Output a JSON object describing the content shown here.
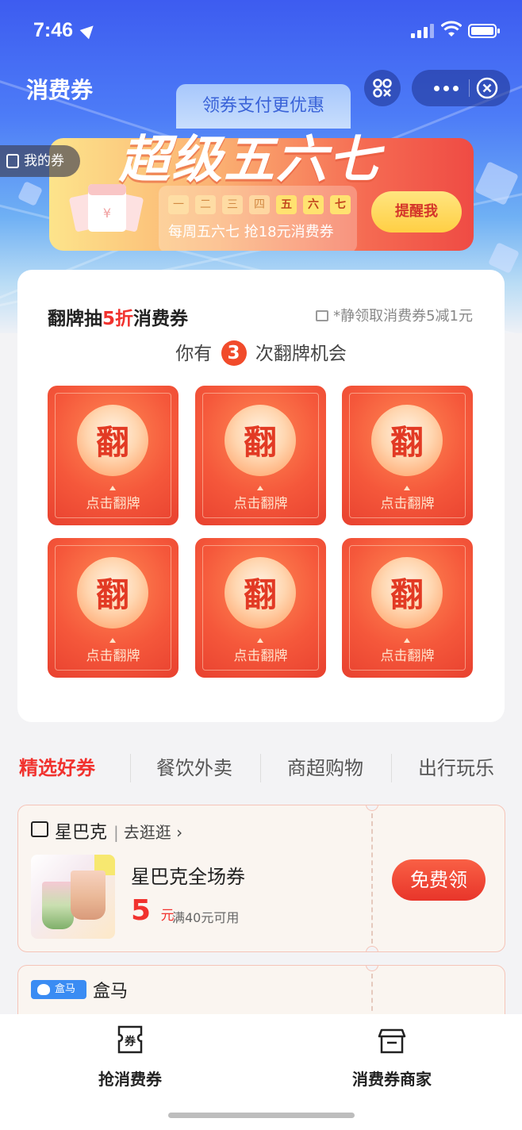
{
  "status_bar": {
    "time": "7:46"
  },
  "nav": {
    "title": "消费券"
  },
  "banner": {
    "tab_label": "领券支付更优惠",
    "headline": "超级五六七",
    "my_coupons": "我的券",
    "days": [
      "一",
      "二",
      "三",
      "四",
      "五",
      "六",
      "七"
    ],
    "subtitle": "每周五六七 抢18元消费券",
    "remind_label": "提醒我"
  },
  "flip": {
    "title_prefix": "翻牌抽",
    "title_highlight": "5折",
    "title_suffix": "消费券",
    "notice": "*静领取消费券5减1元",
    "chances_prefix": "你有",
    "chances_count": "3",
    "chances_suffix": "次翻牌机会",
    "tiles": [
      {
        "char": "翻",
        "label": "点击翻牌"
      },
      {
        "char": "翻",
        "label": "点击翻牌"
      },
      {
        "char": "翻",
        "label": "点击翻牌"
      },
      {
        "char": "翻",
        "label": "点击翻牌"
      },
      {
        "char": "翻",
        "label": "点击翻牌"
      },
      {
        "char": "翻",
        "label": "点击翻牌"
      }
    ]
  },
  "tabs": [
    "精选好券",
    "餐饮外卖",
    "商超购物",
    "出行玩乐"
  ],
  "coupons": [
    {
      "store": "星巴克",
      "go_label": "去逛逛",
      "title": "星巴克全场券",
      "price": "5",
      "unit": "元",
      "condition": "满40元可用",
      "button": "免费领"
    },
    {
      "badge": "盒马",
      "store": "盒马"
    }
  ],
  "bottom_nav": [
    "抢消费券",
    "消费券商家"
  ],
  "colors": {
    "accent": "#f1322e",
    "hero_blue": "#3d5cf0",
    "banner_orange": "#f56a52"
  }
}
